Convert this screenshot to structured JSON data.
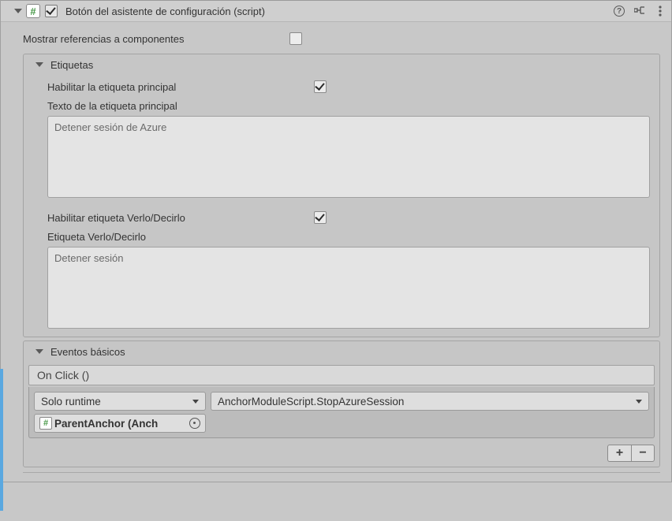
{
  "header": {
    "title": "Botón del asistente de configuración (script)"
  },
  "fields": {
    "show_refs_label": "Mostrar referencias a componentes"
  },
  "labels_group": {
    "title": "Etiquetas",
    "enable_main_label": "Habilitar la etiqueta principal",
    "main_label_text_label": "Texto de la etiqueta principal",
    "main_label_text_value": "Detener sesión de Azure",
    "enable_seeit_label": "Habilitar etiqueta  Verlo/Decirlo",
    "seeit_label_label": "Etiqueta  Verlo/Decirlo",
    "seeit_label_value": "Detener sesión"
  },
  "events_group": {
    "title": "Eventos básicos",
    "onclick_label": "On Click ()",
    "call_state": "Solo runtime",
    "function": "AnchorModuleScript.StopAzureSession",
    "target_object": "ParentAnchor (Anch"
  },
  "buttons": {
    "plus": "+",
    "minus": "−"
  }
}
